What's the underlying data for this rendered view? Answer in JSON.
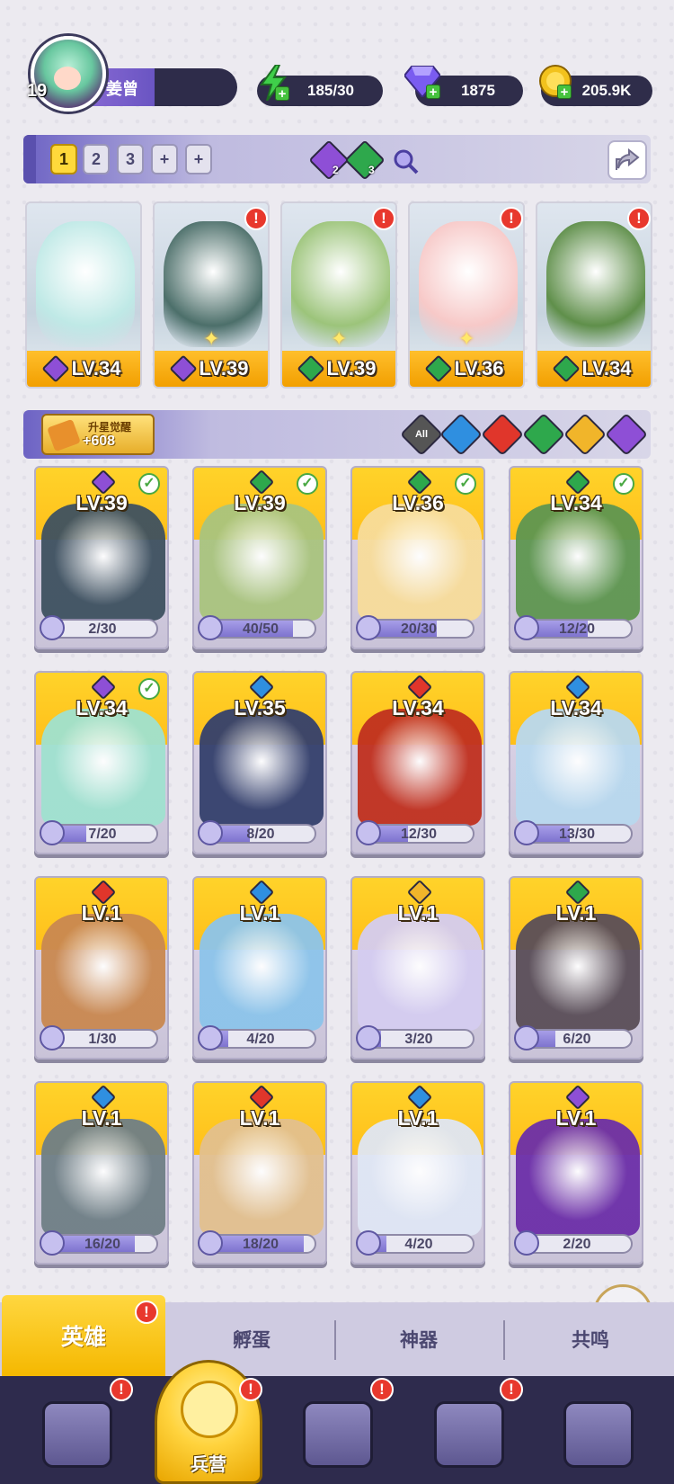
{
  "player": {
    "level": "19",
    "name": "姜曾"
  },
  "resources": [
    {
      "name": "energy",
      "icon": "lightning-icon",
      "value": "185/30",
      "color": "#3fcf4a"
    },
    {
      "name": "gems",
      "icon": "diamond-icon",
      "value": "1875",
      "color": "#7a5cf0"
    },
    {
      "name": "coins",
      "icon": "coin-icon",
      "value": "205.9K",
      "color": "#f2c21d"
    }
  ],
  "team_bar": {
    "tabs": [
      "1",
      "2",
      "3",
      "+",
      "+"
    ],
    "active_tab": "1",
    "element_counts": [
      {
        "element": "dark",
        "count": "2",
        "color": "#8e4fd6"
      },
      {
        "element": "nature",
        "count": "3",
        "color": "#2ea84c"
      }
    ]
  },
  "team": [
    {
      "level": "LV.34",
      "element": "dark",
      "color": "#8e4fd6",
      "alert": false,
      "star": false,
      "art": "#bfe9e6"
    },
    {
      "level": "LV.39",
      "element": "dark",
      "color": "#8e4fd6",
      "alert": true,
      "star": true,
      "art": "#4c6f6a"
    },
    {
      "level": "LV.39",
      "element": "nature",
      "color": "#2ea84c",
      "alert": true,
      "star": true,
      "art": "#9cc47a"
    },
    {
      "level": "LV.36",
      "element": "nature",
      "color": "#2ea84c",
      "alert": true,
      "star": true,
      "art": "#f7c9c8"
    },
    {
      "level": "LV.34",
      "element": "nature",
      "color": "#2ea84c",
      "alert": true,
      "star": false,
      "art": "#5f8f4a"
    }
  ],
  "awaken": {
    "label": "升星觉醒",
    "count": "+608"
  },
  "filters": [
    {
      "name": "all",
      "label": "All",
      "color": "#5a5a5a"
    },
    {
      "name": "water",
      "label": "",
      "color": "#2f8fe0"
    },
    {
      "name": "fire",
      "label": "",
      "color": "#e0362b"
    },
    {
      "name": "nature",
      "label": "",
      "color": "#2ea84c"
    },
    {
      "name": "light",
      "label": "",
      "color": "#f1b52a"
    },
    {
      "name": "dark",
      "label": "",
      "color": "#8e4fd6"
    }
  ],
  "heroes": [
    {
      "level": "LV.39",
      "element_color": "#8e4fd6",
      "checked": true,
      "progress": "2/30",
      "fill": 0.07,
      "art": "#3e5160"
    },
    {
      "level": "LV.39",
      "element_color": "#2ea84c",
      "checked": true,
      "progress": "40/50",
      "fill": 0.8,
      "art": "#a9c47e"
    },
    {
      "level": "LV.36",
      "element_color": "#2ea84c",
      "checked": true,
      "progress": "20/30",
      "fill": 0.67,
      "art": "#f7dc9a"
    },
    {
      "level": "LV.34",
      "element_color": "#2ea84c",
      "checked": true,
      "progress": "12/20",
      "fill": 0.6,
      "art": "#5e9650"
    },
    {
      "level": "LV.34",
      "element_color": "#8e4fd6",
      "checked": true,
      "progress": "7/20",
      "fill": 0.35,
      "art": "#9fe1cf"
    },
    {
      "level": "LV.35",
      "element_color": "#2f8fe0",
      "checked": false,
      "progress": "8/20",
      "fill": 0.4,
      "art": "#34406c"
    },
    {
      "level": "LV.34",
      "element_color": "#e0362b",
      "checked": false,
      "progress": "12/30",
      "fill": 0.4,
      "art": "#c0301f"
    },
    {
      "level": "LV.34",
      "element_color": "#2f8fe0",
      "checked": false,
      "progress": "13/30",
      "fill": 0.43,
      "art": "#b8d8ee"
    },
    {
      "level": "LV.1",
      "element_color": "#e0362b",
      "checked": false,
      "progress": "1/30",
      "fill": 0.03,
      "art": "#c98850"
    },
    {
      "level": "LV.1",
      "element_color": "#2f8fe0",
      "checked": false,
      "progress": "4/20",
      "fill": 0.2,
      "art": "#8cc4ea"
    },
    {
      "level": "LV.1",
      "element_color": "#f1b52a",
      "checked": false,
      "progress": "3/20",
      "fill": 0.15,
      "art": "#d4ccf0"
    },
    {
      "level": "LV.1",
      "element_color": "#2ea84c",
      "checked": false,
      "progress": "6/20",
      "fill": 0.3,
      "art": "#5a4e58"
    },
    {
      "level": "LV.1",
      "element_color": "#2f8fe0",
      "checked": false,
      "progress": "16/20",
      "fill": 0.8,
      "art": "#6f7f86"
    },
    {
      "level": "LV.1",
      "element_color": "#e0362b",
      "checked": false,
      "progress": "18/20",
      "fill": 0.9,
      "art": "#e2c08e"
    },
    {
      "level": "LV.1",
      "element_color": "#2f8fe0",
      "checked": false,
      "progress": "4/20",
      "fill": 0.2,
      "art": "#dfe6f4"
    },
    {
      "level": "LV.1",
      "element_color": "#8e4fd6",
      "checked": false,
      "progress": "2/20",
      "fill": 0.1,
      "art": "#6c2fa8"
    }
  ],
  "sub_tabs": [
    "英雄",
    "孵蛋",
    "神器",
    "共鸣"
  ],
  "active_sub_tab": "英雄",
  "bottom_nav": [
    {
      "name": "cards",
      "icon": "cards-icon",
      "label": "",
      "alert": true
    },
    {
      "name": "barracks",
      "icon": "barracks-icon",
      "label": "兵营",
      "alert": true,
      "active": true
    },
    {
      "name": "book",
      "icon": "book-icon",
      "label": "",
      "alert": true
    },
    {
      "name": "temple",
      "icon": "temple-icon",
      "label": "",
      "alert": true
    },
    {
      "name": "mushroom",
      "icon": "mushroom-icon",
      "label": "",
      "alert": false
    }
  ],
  "alert_mark": "!"
}
